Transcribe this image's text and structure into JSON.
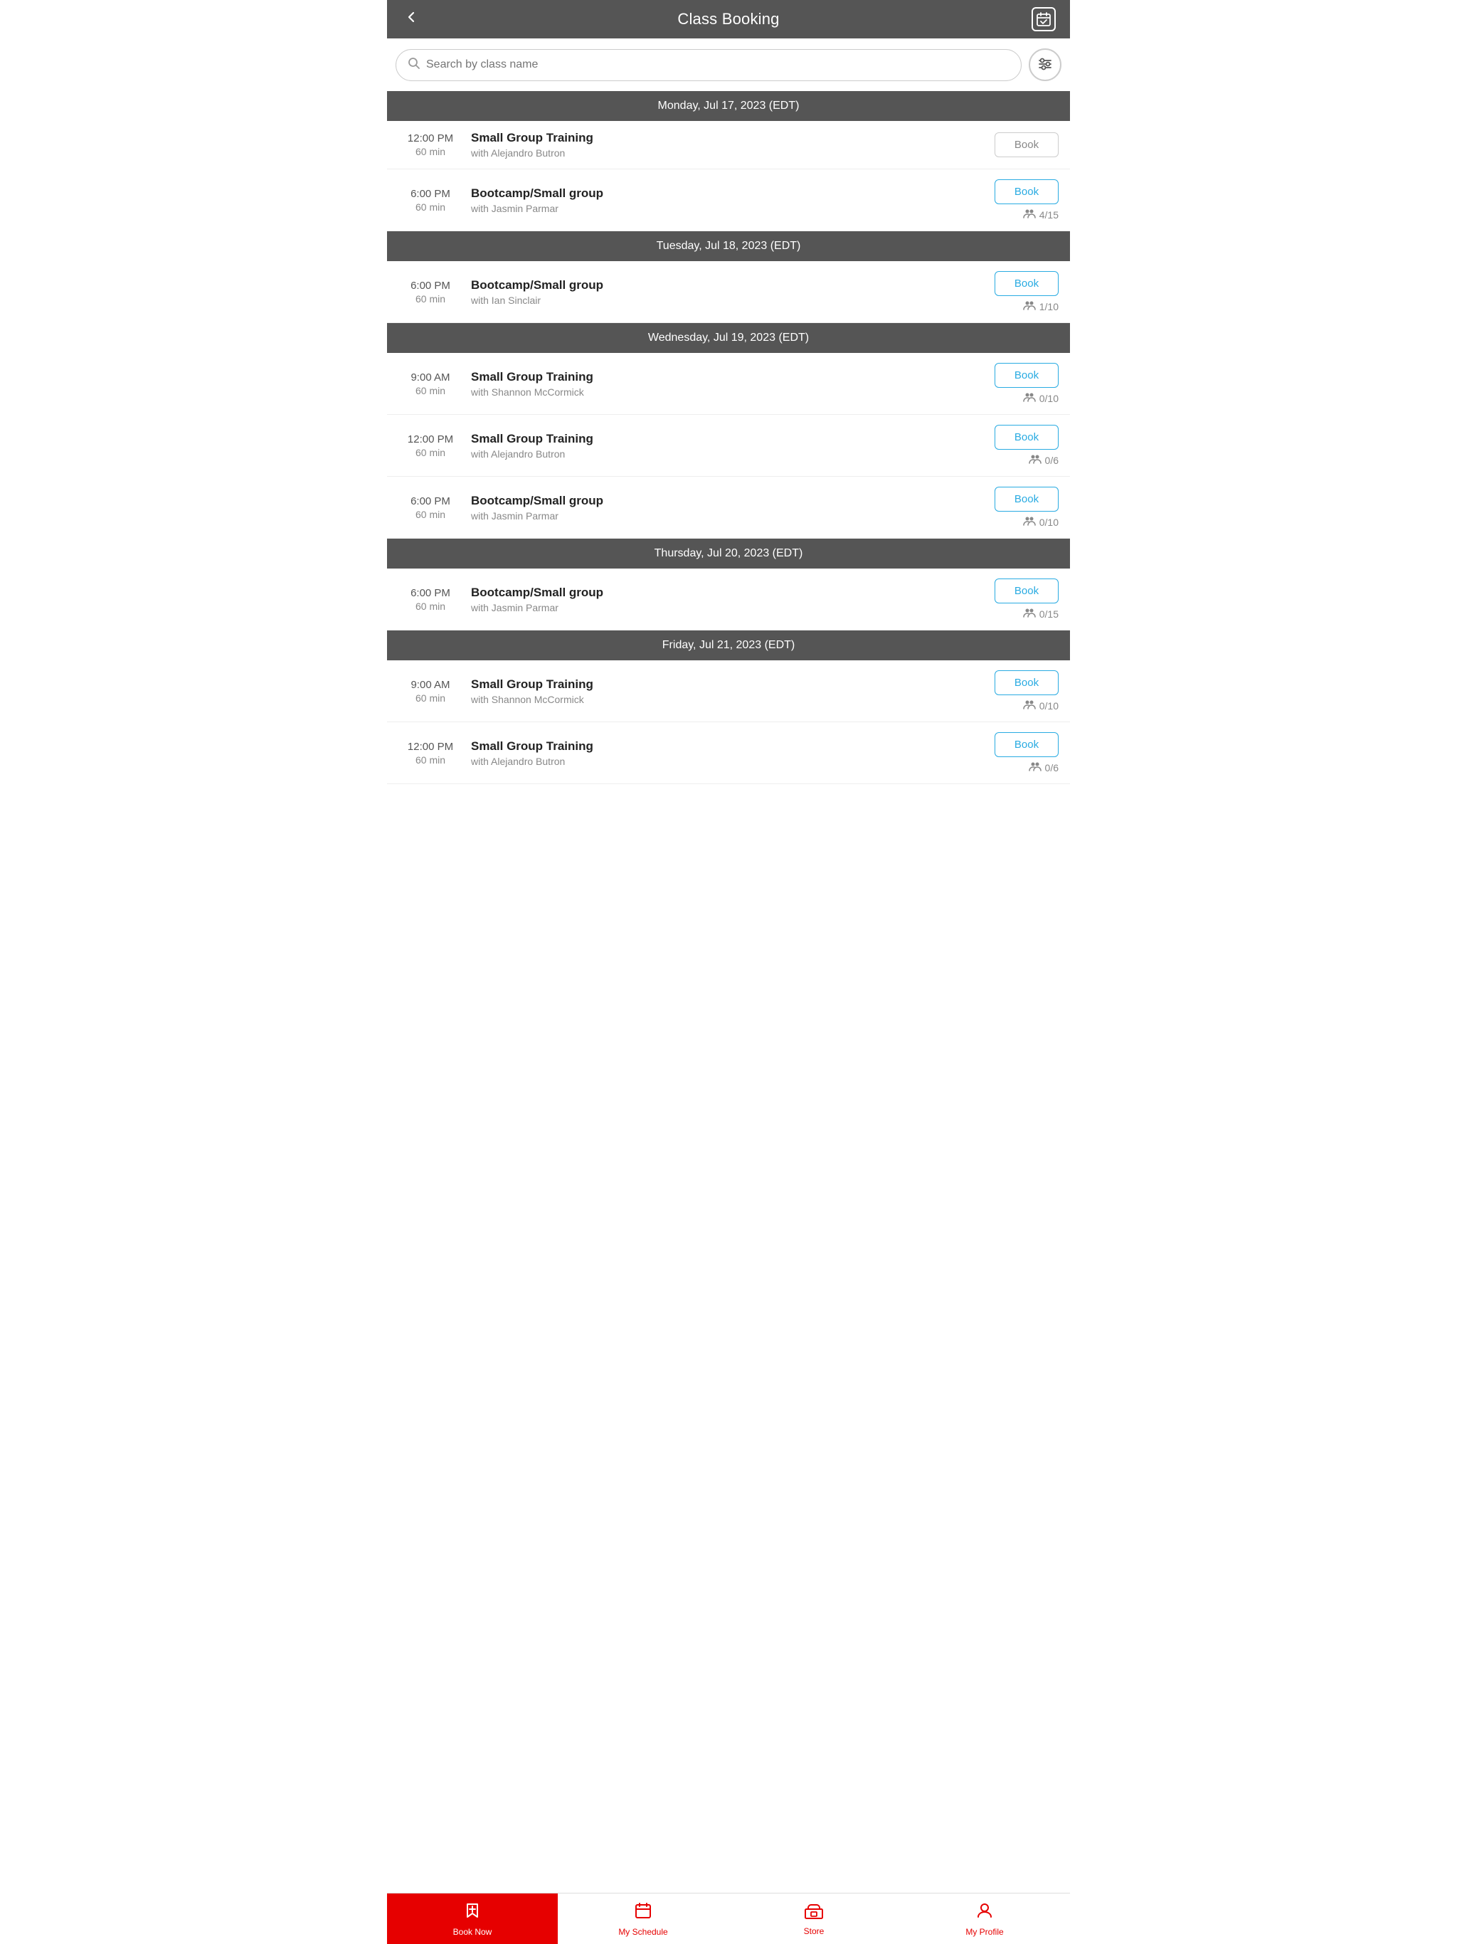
{
  "header": {
    "title": "Class Booking",
    "back_label": "‹",
    "calendar_icon": "calendar-check-icon"
  },
  "search": {
    "placeholder": "Search by class name",
    "filter_icon": "filter-icon"
  },
  "days": [
    {
      "label": "Monday, Jul 17, 2023 (EDT)",
      "classes": [
        {
          "time": "12:00 PM",
          "duration": "60 min",
          "name": "Small Group Training",
          "trainer": "with Alejandro Butron",
          "book_label": "Book",
          "book_active": false,
          "capacity": null
        },
        {
          "time": "6:00 PM",
          "duration": "60 min",
          "name": "Bootcamp/Small group",
          "trainer": "with Jasmin Parmar",
          "book_label": "Book",
          "book_active": true,
          "capacity": "4/15"
        }
      ]
    },
    {
      "label": "Tuesday, Jul 18, 2023 (EDT)",
      "classes": [
        {
          "time": "6:00 PM",
          "duration": "60 min",
          "name": "Bootcamp/Small group",
          "trainer": "with Ian Sinclair",
          "book_label": "Book",
          "book_active": true,
          "capacity": "1/10"
        }
      ]
    },
    {
      "label": "Wednesday, Jul 19, 2023 (EDT)",
      "classes": [
        {
          "time": "9:00 AM",
          "duration": "60 min",
          "name": "Small Group Training",
          "trainer": "with Shannon McCormick",
          "book_label": "Book",
          "book_active": true,
          "capacity": "0/10"
        },
        {
          "time": "12:00 PM",
          "duration": "60 min",
          "name": "Small Group Training",
          "trainer": "with Alejandro Butron",
          "book_label": "Book",
          "book_active": true,
          "capacity": "0/6"
        },
        {
          "time": "6:00 PM",
          "duration": "60 min",
          "name": "Bootcamp/Small group",
          "trainer": "with Jasmin Parmar",
          "book_label": "Book",
          "book_active": true,
          "capacity": "0/10"
        }
      ]
    },
    {
      "label": "Thursday, Jul 20, 2023 (EDT)",
      "classes": [
        {
          "time": "6:00 PM",
          "duration": "60 min",
          "name": "Bootcamp/Small group",
          "trainer": "with Jasmin Parmar",
          "book_label": "Book",
          "book_active": true,
          "capacity": "0/15"
        }
      ]
    },
    {
      "label": "Friday, Jul 21, 2023 (EDT)",
      "classes": [
        {
          "time": "9:00 AM",
          "duration": "60 min",
          "name": "Small Group Training",
          "trainer": "with Shannon McCormick",
          "book_label": "Book",
          "book_active": true,
          "capacity": "0/10"
        },
        {
          "time": "12:00 PM",
          "duration": "60 min",
          "name": "Small Group Training",
          "trainer": "with Alejandro Butron",
          "book_label": "Book",
          "book_active": true,
          "capacity": "0/6"
        }
      ]
    }
  ],
  "bottom_nav": [
    {
      "label": "Book Now",
      "icon": "bookmark-icon",
      "active": true
    },
    {
      "label": "My Schedule",
      "icon": "calendar-icon",
      "active": false
    },
    {
      "label": "Store",
      "icon": "store-icon",
      "active": false
    },
    {
      "label": "My Profile",
      "icon": "profile-icon",
      "active": false
    }
  ]
}
